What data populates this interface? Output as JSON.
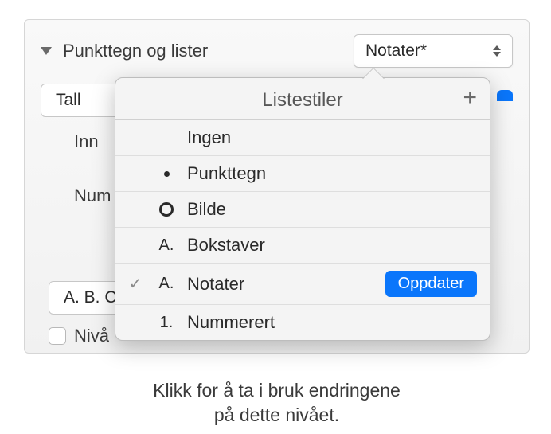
{
  "header": {
    "section_label": "Punkttegn og lister",
    "dropdown_value": "Notater*"
  },
  "controls": {
    "type_value": "Tall",
    "side_label_1": "Inn",
    "side_label_2": "Num",
    "format_value": "A. B. C.",
    "checkbox_label": "Nivå"
  },
  "popover": {
    "title": "Listestiler",
    "items": [
      {
        "bullet": "",
        "label": "Ingen"
      },
      {
        "bullet": "dot",
        "label": "Punkttegn"
      },
      {
        "bullet": "ring",
        "label": "Bilde"
      },
      {
        "bullet": "A.",
        "label": "Bokstaver"
      },
      {
        "bullet": "A.",
        "label": "Notater",
        "checked": true,
        "action": "Oppdater"
      },
      {
        "bullet": "1.",
        "label": "Nummerert"
      }
    ]
  },
  "callout": {
    "line1": "Klikk for å ta i bruk endringene",
    "line2": "på dette nivået."
  }
}
